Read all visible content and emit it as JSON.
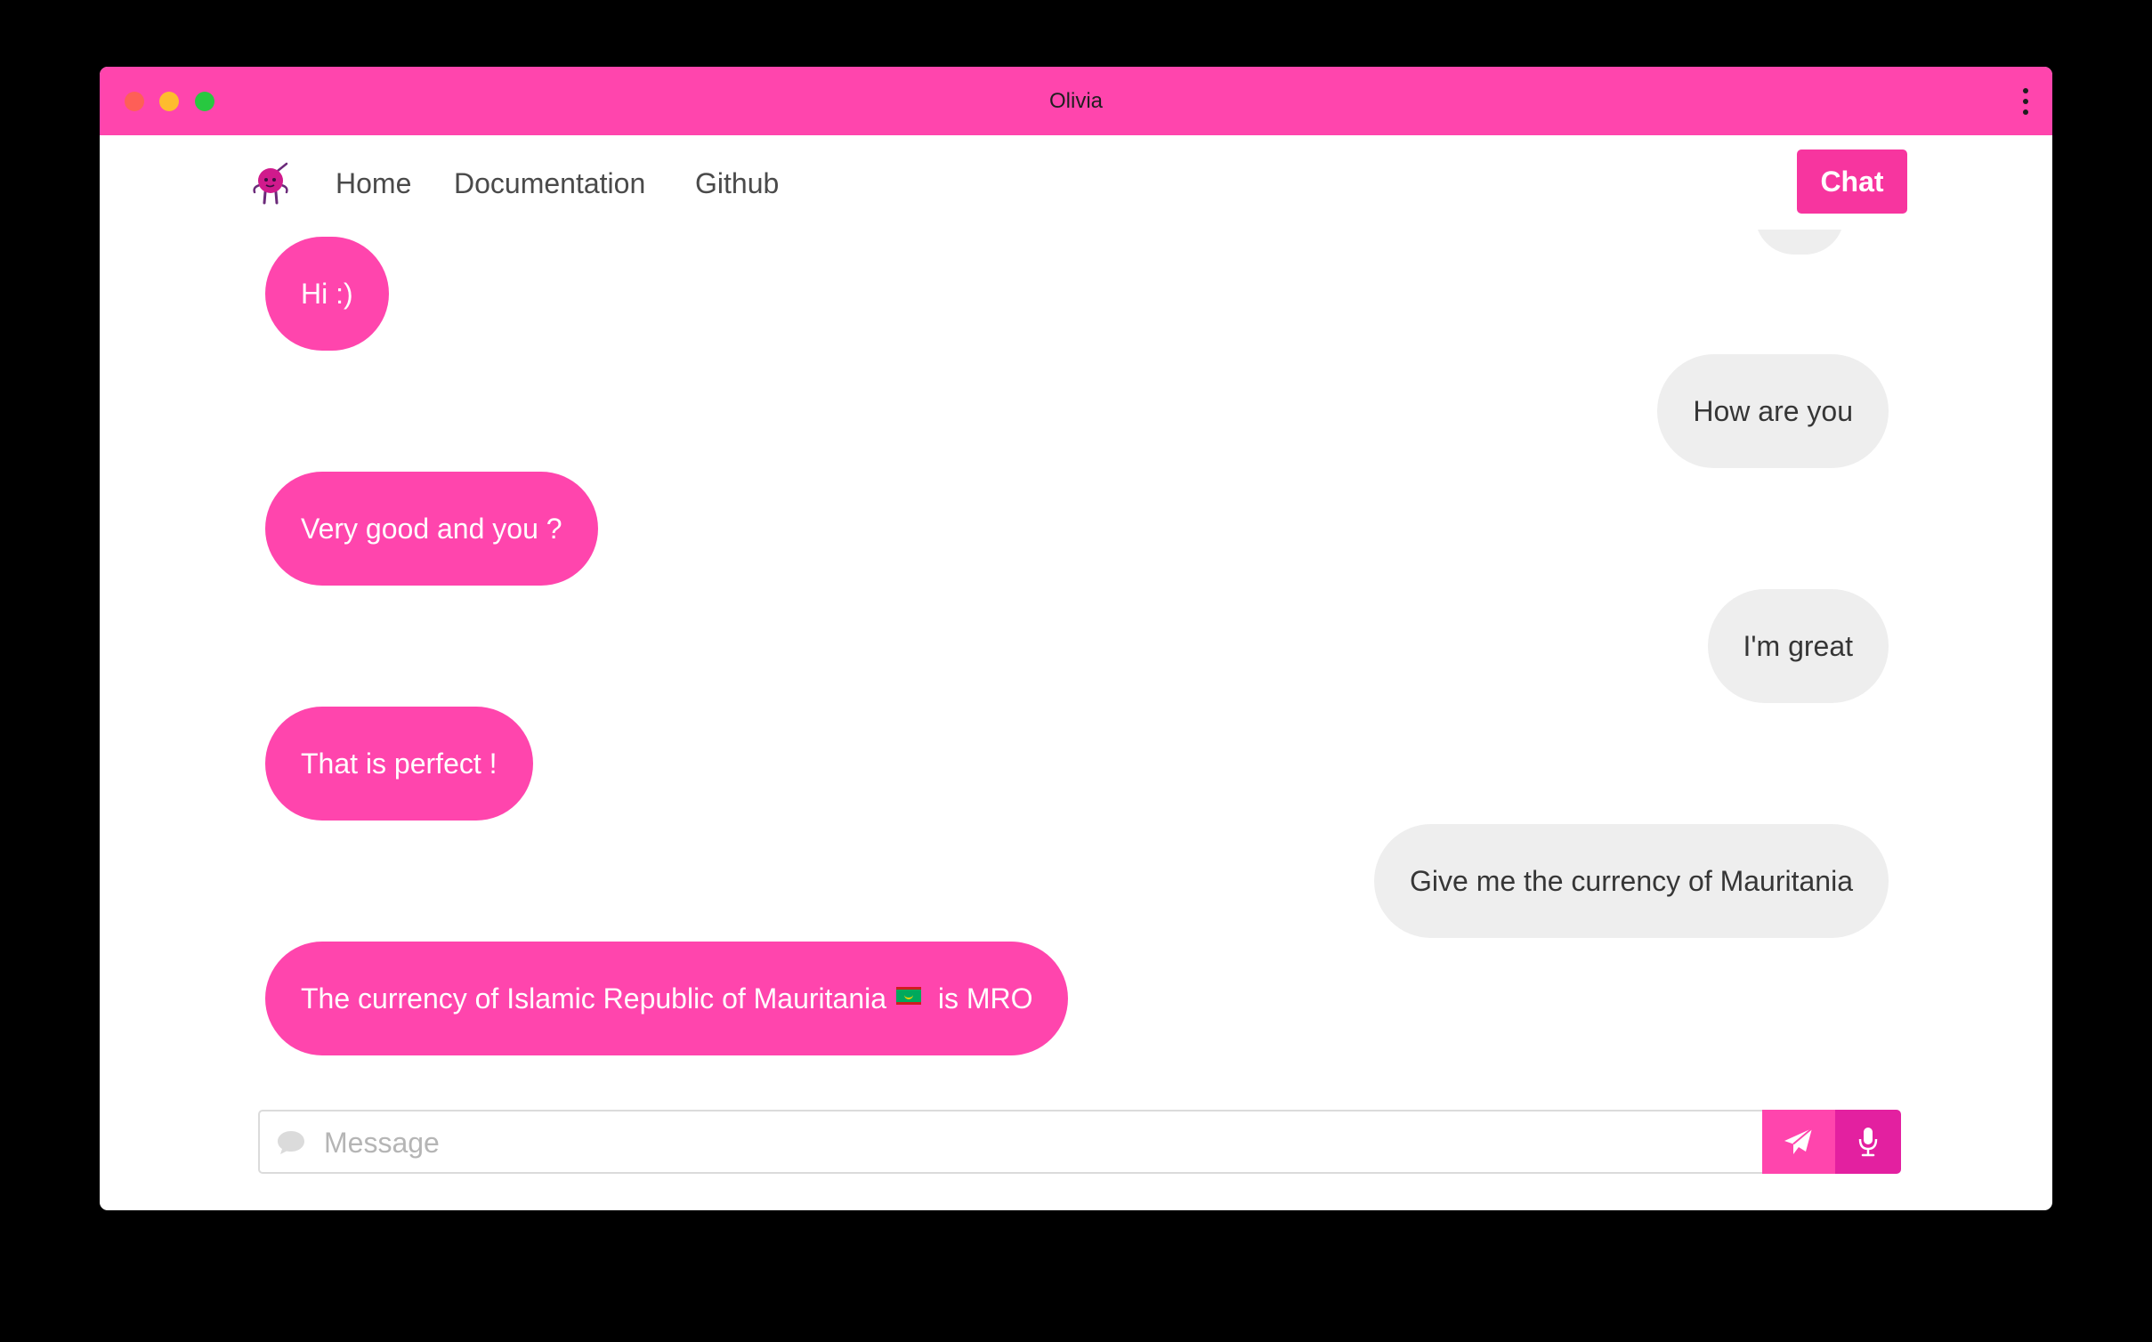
{
  "window": {
    "title": "Olivia"
  },
  "nav": {
    "logo": "olivia-robot-icon",
    "links": [
      "Home",
      "Documentation",
      "Github"
    ],
    "chat_button": "Chat"
  },
  "messages": [
    {
      "from": "bot",
      "text": "Hi :)"
    },
    {
      "from": "user",
      "text": "How are you"
    },
    {
      "from": "bot",
      "text": "Very good and you ?"
    },
    {
      "from": "user",
      "text": "I'm great"
    },
    {
      "from": "bot",
      "text": "That is perfect !"
    },
    {
      "from": "user",
      "text": "Give me the currency of Mauritania"
    },
    {
      "from": "bot",
      "text_before": "The currency of Islamic Republic of Mauritania",
      "flag": "mauritania-flag-icon",
      "text_after": "is MRO"
    }
  ],
  "composer": {
    "placeholder": "Message",
    "value": "",
    "icons": [
      "chat-bubble-icon",
      "send-icon",
      "microphone-icon"
    ]
  },
  "colors": {
    "accent": "#ff45ad",
    "chat_button": "#f7359f",
    "mic_button": "#e320a0",
    "user_bubble": "#eeeeee"
  }
}
